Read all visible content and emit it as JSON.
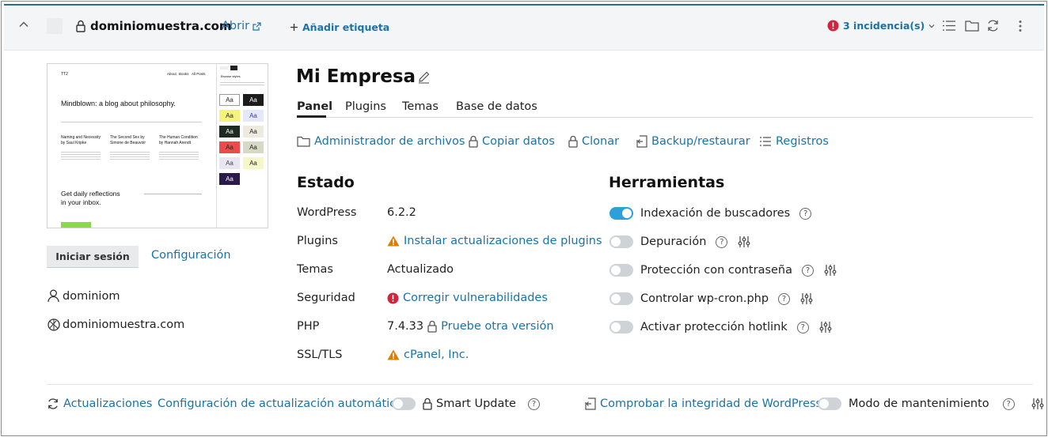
{
  "header": {
    "domain": "dominiomuestra.com",
    "open_label": "Abrir",
    "add_tag_label": "Añadir etiqueta",
    "issues_label": "3 incidencia(s)"
  },
  "site": {
    "title": "Mi Empresa",
    "login_label": "Iniciar sesión",
    "config_label": "Configuración",
    "username": "dominiom",
    "domain": "dominiomuestra.com"
  },
  "preview": {
    "brand": "TT2",
    "nav": [
      "About",
      "Books",
      "All Posts"
    ],
    "headline": "Mindblown: a blog about philosophy.",
    "posts": [
      "Naming and Necessity by Saul Kripke",
      "The Second Sex by Simone de Beauvoir",
      "The Human Condition by Hannah Arendt"
    ],
    "cta": "Get daily reflections in your inbox.",
    "panel_title": "Browse styles",
    "swatch_text": "Aa"
  },
  "tabs": [
    "Panel",
    "Plugins",
    "Temas",
    "Base de datos"
  ],
  "actions": [
    "Administrador de archivos",
    "Copiar datos",
    "Clonar",
    "Backup/restaurar",
    "Registros"
  ],
  "status": {
    "heading": "Estado",
    "rows": [
      {
        "label": "WordPress",
        "value": "6.2.2"
      },
      {
        "label": "Plugins",
        "value": "Instalar actualizaciones de plugins"
      },
      {
        "label": "Temas",
        "value": "Actualizado"
      },
      {
        "label": "Seguridad",
        "value": "Corregir vulnerabilidades"
      },
      {
        "label": "PHP",
        "value": "7.4.33",
        "link": "Pruebe otra versión"
      },
      {
        "label": "SSL/TLS",
        "value": "cPanel, Inc."
      }
    ]
  },
  "tools": {
    "heading": "Herramientas",
    "items": [
      {
        "label": "Indexación de buscadores",
        "on": true
      },
      {
        "label": "Depuración",
        "on": false
      },
      {
        "label": "Protección con contraseña",
        "on": false
      },
      {
        "label": "Controlar wp-cron.php",
        "on": false
      },
      {
        "label": "Activar protección hotlink",
        "on": false
      }
    ]
  },
  "footer": {
    "updates": "Actualizaciones",
    "auto_update": "Configuración de actualización automática",
    "smart_update": "Smart Update",
    "integrity": "Comprobar la integridad de WordPress",
    "maintenance": "Modo de mantenimiento"
  },
  "colors": {
    "link": "#1a73a8",
    "warning": "#e07b00",
    "error": "#d0253f",
    "toggle_on": "#2d9fd9",
    "header_bg": "#f4f5f6"
  }
}
